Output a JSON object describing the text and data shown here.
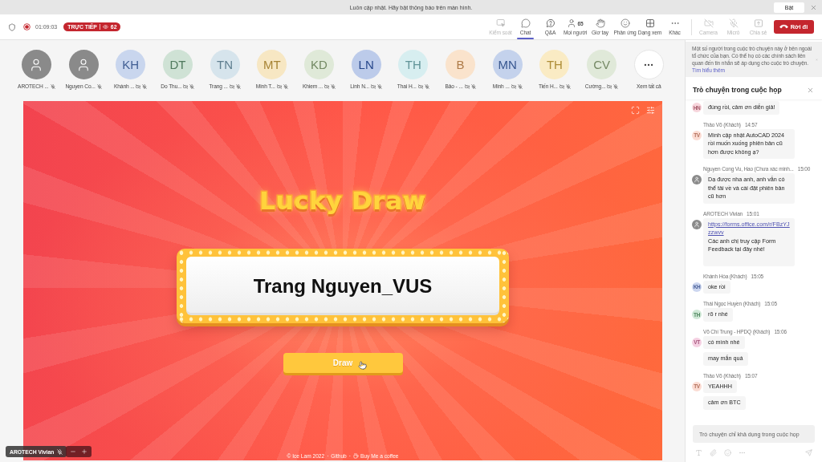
{
  "notification_bar": {
    "message": "Luôn cập nhật. Hãy bật thông báo trên màn hình.",
    "button": "Bật"
  },
  "meeting_bar": {
    "recording": true,
    "elapsed": "01:09:03",
    "live_badge": {
      "label": "TRỰC TIẾP",
      "viewers": "62"
    },
    "tools": [
      {
        "kind": "control",
        "label": "Kiểm soát",
        "selected": false,
        "disabled": true
      },
      {
        "kind": "chat",
        "label": "Chat",
        "selected": true,
        "disabled": false
      },
      {
        "kind": "qa",
        "label": "Q&A",
        "selected": false,
        "disabled": false
      },
      {
        "kind": "people",
        "label": "Mọi người",
        "count": "65",
        "selected": false,
        "disabled": false
      },
      {
        "kind": "hand",
        "label": "Giơ tay",
        "selected": false,
        "disabled": false
      },
      {
        "kind": "react",
        "label": "Phản ứng",
        "selected": false,
        "disabled": false
      },
      {
        "kind": "view",
        "label": "Dạng xem",
        "selected": false,
        "disabled": false
      },
      {
        "kind": "more",
        "label": "Khác",
        "selected": false,
        "disabled": false
      }
    ],
    "devices": [
      {
        "kind": "camera",
        "label": "Camera",
        "disabled": true
      },
      {
        "kind": "mic",
        "label": "Micrô",
        "disabled": true
      },
      {
        "kind": "share",
        "label": "Chia sẻ",
        "disabled": true
      }
    ],
    "leave_button": "Rời đi"
  },
  "participants": [
    {
      "kind": "guest",
      "name": "AROTECH ...",
      "muted": true,
      "camera_off": false
    },
    {
      "kind": "guest",
      "name": "Nguyen Co...",
      "muted": true,
      "camera_off": false
    },
    {
      "kind": "initials",
      "initials": "KH",
      "color": "#c9d6ee",
      "name": "Khánh ...",
      "muted": true,
      "camera_off": true
    },
    {
      "kind": "initials",
      "initials": "DT",
      "color": "#cfe2d5",
      "name": "Do Thu...",
      "muted": true,
      "camera_off": true
    },
    {
      "kind": "initials",
      "initials": "TN",
      "color": "#d6e4ec",
      "name": "Trang ...",
      "muted": true,
      "camera_off": true
    },
    {
      "kind": "initials",
      "initials": "MT",
      "color": "#f7e7c3",
      "name": "Minh T...",
      "muted": true,
      "camera_off": true
    },
    {
      "kind": "initials",
      "initials": "KD",
      "color": "#dfe9d8",
      "name": "Khiem ...",
      "muted": true,
      "camera_off": true
    },
    {
      "kind": "initials",
      "initials": "LN",
      "color": "#bccbea",
      "name": "Linh N...",
      "muted": true,
      "camera_off": true
    },
    {
      "kind": "initials",
      "initials": "TH",
      "color": "#d7eef0",
      "name": "Thai H...",
      "muted": true,
      "camera_off": true
    },
    {
      "kind": "initials",
      "initials": "B",
      "color": "#fae3cc",
      "name": "Bảo - ...",
      "muted": true,
      "camera_off": true
    },
    {
      "kind": "initials",
      "initials": "MN",
      "color": "#c4d2ec",
      "name": "Minh ...",
      "muted": true,
      "camera_off": true
    },
    {
      "kind": "initials",
      "initials": "TH",
      "color": "#faebc4",
      "name": "Tiến H...",
      "muted": true,
      "camera_off": true
    },
    {
      "kind": "initials",
      "initials": "CV",
      "color": "#e0e9d9",
      "name": "Cường...",
      "muted": true,
      "camera_off": true
    }
  ],
  "see_all": "Xem tất cả",
  "stage": {
    "title": "Lucky Draw",
    "winner": "Trang Nguyen_VUS",
    "draw_button": "Draw",
    "footer": [
      {
        "kind": "text",
        "text": "© Ice Lam 2022"
      },
      {
        "kind": "separator",
        "text": "·"
      },
      {
        "kind": "link",
        "text": "Github"
      },
      {
        "kind": "separator",
        "text": "·"
      },
      {
        "kind": "coffee-link",
        "text": "Buy Me a coffee"
      }
    ]
  },
  "speaker_tag": {
    "name": "AROTECH Vivian",
    "muted": true
  },
  "chat": {
    "notice": {
      "text": "Một số người trong cuộc trò chuyện này ở bên ngoài tổ chức của bạn. Có thể họ có các chính sách liên quan đến tin nhắn sẽ áp dụng cho cuộc trò chuyện.",
      "link": "Tìm hiểu thêm"
    },
    "title": "Trò chuyện trong cuộc họp",
    "messages": [
      {
        "avatar": {
          "kind": "initials",
          "initials": "HN",
          "color": "#f7d5dc"
        },
        "bubbles": [
          {
            "text": "đúng rồi, cảm ơn diễn giả!"
          }
        ]
      },
      {
        "sender": "Thảo Võ (Khách)",
        "time": "14:57",
        "avatar": {
          "kind": "initials",
          "initials": "TV",
          "color": "#fbdcd3"
        },
        "bubbles": [
          {
            "text": "Mình cập nhật AutoCAD 2024 rồi muốn xuống phiên bản cũ hơn được không ạ?"
          }
        ]
      },
      {
        "sender": "Nguyen Cong Vu, Hao (Chưa xác minh...",
        "time": "15:00",
        "avatar": {
          "kind": "guest"
        },
        "bubbles": [
          {
            "text": "Dạ được nha anh, anh vẫn có thể tải về và cài đặt phiên bản cũ hơn"
          }
        ]
      },
      {
        "sender": "AROTECH Vivian",
        "time": "15:01",
        "avatar": {
          "kind": "guest"
        },
        "bubbles": [
          {
            "link": "https://forms.office.com/r/FBzYJzzwvv",
            "text": "Các anh chị truy cập Form Feedback tại đây nhé!"
          }
        ]
      },
      {
        "sender": "Khánh Hòa (Khách)",
        "time": "15:05",
        "avatar": {
          "kind": "initials",
          "initials": "KH",
          "color": "#cdd7f0"
        },
        "bubbles": [
          {
            "text": "oke rồi"
          }
        ]
      },
      {
        "sender": "Thái Ngọc Huyền (Khách)",
        "time": "15:05",
        "avatar": {
          "kind": "initials",
          "initials": "TH",
          "color": "#cfe8d6"
        },
        "bubbles": [
          {
            "text": "rõ r nhé"
          }
        ]
      },
      {
        "sender": "Võ Chí Trung - HPDQ (Khách)",
        "time": "15:06",
        "avatar": {
          "kind": "initials",
          "initials": "VT",
          "color": "#f5d0e2"
        },
        "bubbles": [
          {
            "text": "có mình nhé"
          },
          {
            "text": "may mắn quá"
          }
        ]
      },
      {
        "sender": "Thảo Võ (Khách)",
        "time": "15:07",
        "avatar": {
          "kind": "initials",
          "initials": "TV",
          "color": "#fbdcd3"
        },
        "bubbles": [
          {
            "text": "YEAHHH"
          },
          {
            "text": "cảm ơn BTC"
          }
        ]
      }
    ],
    "composer": {
      "placeholder": "Trò chuyện chỉ khả dụng trong cuộc họp"
    }
  }
}
